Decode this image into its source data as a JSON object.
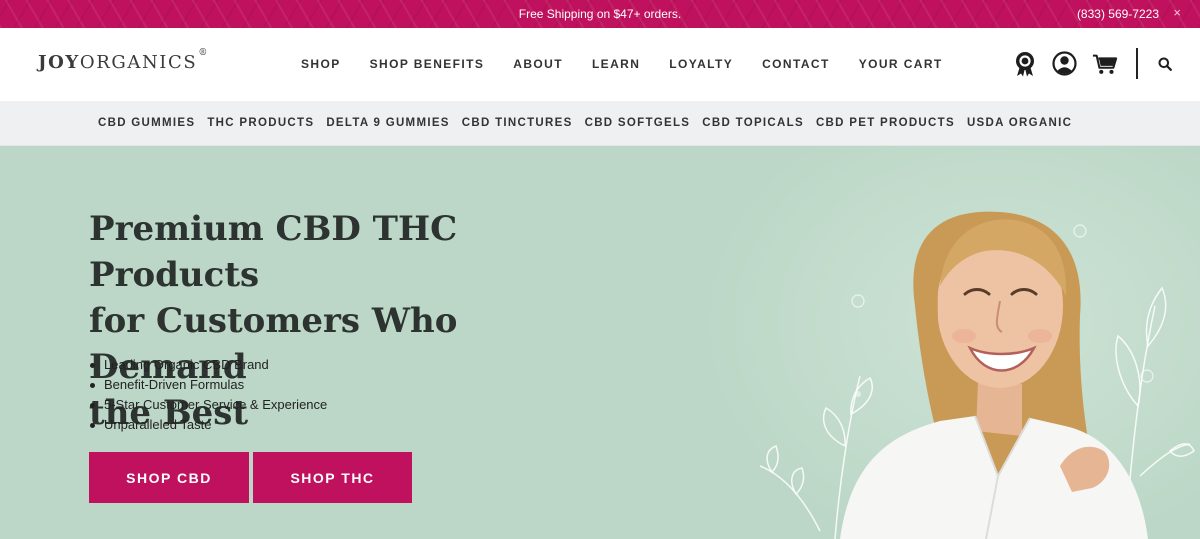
{
  "announcement": {
    "message": "Free Shipping on $47+ orders.",
    "phone": "(833) 569-7223",
    "close_icon": "×"
  },
  "brand": {
    "logo_bold": "JOY",
    "logo_light": "ORGANICS",
    "logo_mark": "®"
  },
  "nav": {
    "items": [
      "SHOP",
      "SHOP BENEFITS",
      "ABOUT",
      "LEARN",
      "LOYALTY",
      "CONTACT",
      "YOUR CART"
    ]
  },
  "header_icons": [
    "rewards-badge-icon",
    "account-icon",
    "cart-icon",
    "search-icon"
  ],
  "categories": {
    "items": [
      "CBD GUMMIES",
      "THC PRODUCTS",
      "DELTA 9 GUMMIES",
      "CBD TINCTURES",
      "CBD SOFTGELS",
      "CBD TOPICALS",
      "CBD PET PRODUCTS",
      "USDA ORGANIC"
    ]
  },
  "hero": {
    "title_line1": "Premium CBD THC Products",
    "title_line2": "for Customers Who Demand",
    "title_line3": "the Best",
    "bullets": [
      "Leading Organic CBD Brand",
      "Benefit-Driven Formulas",
      "5-Star Customer Service & Experience",
      "Unparalleled Taste"
    ],
    "shop_cbd_label": "SHOP CBD",
    "shop_thc_label": "SHOP THC"
  },
  "colors": {
    "brand_magenta": "#c0115e",
    "hero_background": "#bcd7c7",
    "category_bar": "#eef0f2"
  }
}
